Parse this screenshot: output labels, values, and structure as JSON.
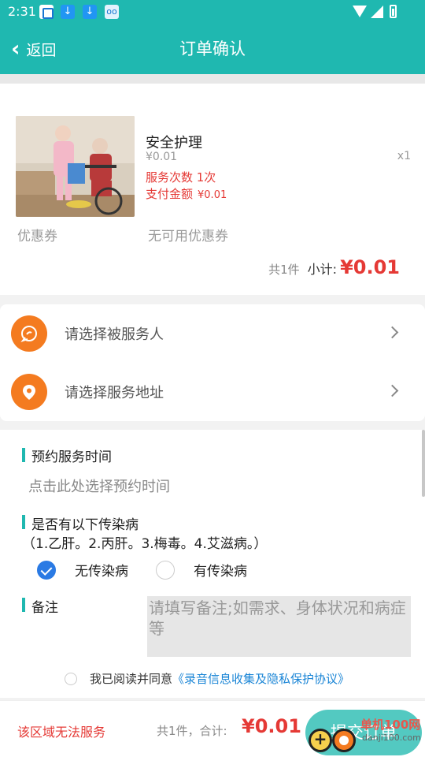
{
  "status_bar": {
    "time": "2:31",
    "icons": [
      "app-icon",
      "download-icon",
      "download-icon",
      "glasses-icon",
      "wifi-icon",
      "signal-icon",
      "battery-icon"
    ]
  },
  "nav": {
    "back_label": "返回",
    "title": "订单确认"
  },
  "product": {
    "name": "安全护理",
    "price": "¥0.01",
    "quantity": "x1",
    "service_count": "服务次数 1次",
    "pay_label": "支付金额",
    "pay_value": "¥0.01",
    "coupon_label": "优惠券",
    "coupon_value": "无可用优惠券",
    "subtotal_count": "共1件",
    "subtotal_label": "小计:",
    "subtotal_value": "¥0.01"
  },
  "selections": {
    "recipient_label": "请选择被服务人",
    "address_label": "请选择服务地址"
  },
  "form": {
    "appointment_title": "预约服务时间",
    "appointment_placeholder": "点击此处选择预约时间",
    "disease_title": "是否有以下传染病",
    "disease_list": "（1.乙肝。2.丙肝。3.梅毒。4.艾滋病。）",
    "option_none": "无传染病",
    "option_has": "有传染病",
    "selected_option": "无传染病",
    "remark_title": "备注",
    "remark_placeholder": "请填写备注;如需求、身体状况和病症等",
    "agree_text": "我已阅读并同意",
    "agree_link": "《录音信息收集及隐私保护协议》"
  },
  "bottom": {
    "region_warning": "该区域无法服务",
    "total_count": "共1件，合计:",
    "total_value": "¥0.01",
    "submit_label": "提交订单"
  },
  "watermark": {
    "text": "单机100网",
    "sub": "danji100.com"
  },
  "colors": {
    "brand": "#1fb8b0",
    "price_red": "#e53935",
    "icon_orange": "#f47b20",
    "link_blue": "#1a85d6"
  }
}
